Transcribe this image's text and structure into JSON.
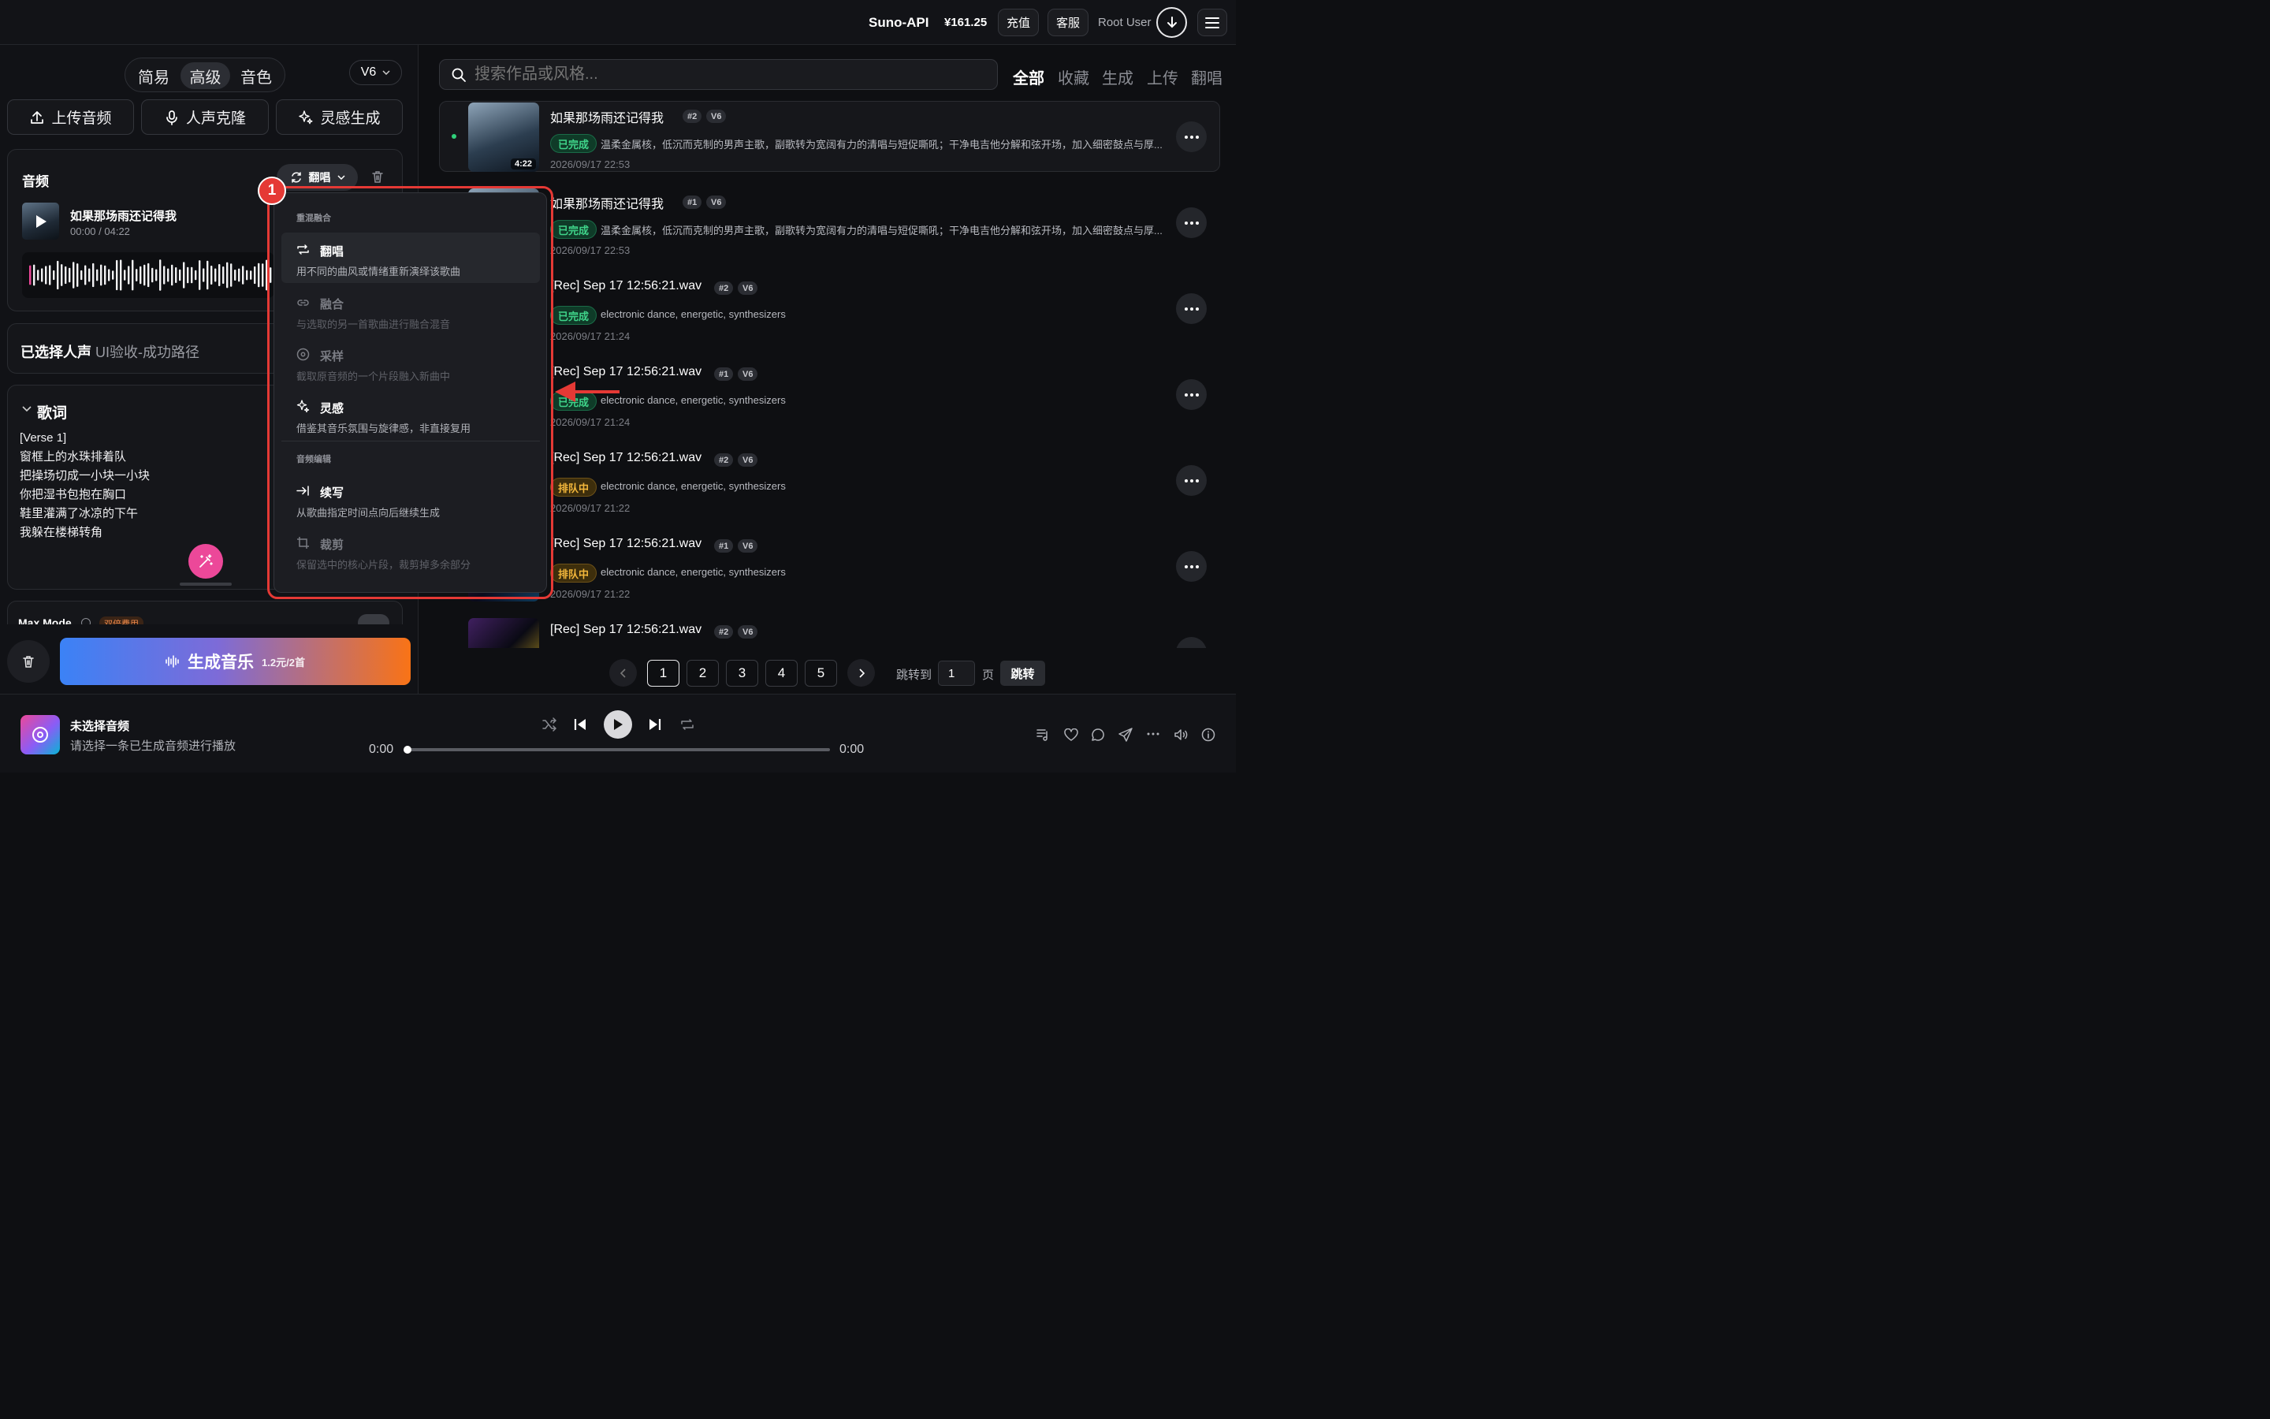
{
  "header": {
    "brand": "Suno-API",
    "balance": "¥161.25",
    "recharge": "充值",
    "support": "客服",
    "user": "Root User"
  },
  "left": {
    "modes": [
      "简易",
      "高级",
      "音色"
    ],
    "version": "V6",
    "tools": [
      "上传音频",
      "人声克隆",
      "灵感生成"
    ],
    "audio_card": {
      "title": "音频",
      "mode_button": "翻唱",
      "track_title": "如果那场雨还记得我",
      "time": "00:00 / 04:22"
    },
    "voice": {
      "label": "已选择人声",
      "value": "UI验收-成功路径"
    },
    "lyrics": {
      "title": "歌词",
      "lines": [
        "[Verse 1]",
        "窗框上的水珠排着队",
        "把操场切成一小块一小块",
        "你把湿书包抱在胸口",
        "鞋里灌满了冰凉的下午",
        "我躲在楼梯转角"
      ]
    },
    "max_mode": {
      "label": "Max Mode",
      "badge": "双倍费用"
    },
    "generate": {
      "label": "生成音乐",
      "price": "1.2元/2首"
    }
  },
  "dropdown": {
    "step_badge": "1",
    "section1": "重混融合",
    "section2": "音频编辑",
    "items": [
      {
        "title": "翻唱",
        "desc": "用不同的曲风或情绪重新演绎该歌曲",
        "icon": "repeat-icon",
        "enabled": true
      },
      {
        "title": "融合",
        "desc": "与选取的另一首歌曲进行融合混音",
        "icon": "link-icon",
        "enabled": false
      },
      {
        "title": "采样",
        "desc": "截取原音频的一个片段融入新曲中",
        "icon": "disc-icon",
        "enabled": false
      },
      {
        "title": "灵感",
        "desc": "借鉴其音乐氛围与旋律感，非直接复用",
        "icon": "sparkle-icon",
        "enabled": true
      },
      {
        "title": "续写",
        "desc": "从歌曲指定时间点向后继续生成",
        "icon": "arrow-right-bar-icon",
        "enabled": true
      },
      {
        "title": "裁剪",
        "desc": "保留选中的核心片段，裁剪掉多余部分",
        "icon": "crop-icon",
        "enabled": false
      }
    ]
  },
  "right": {
    "search_placeholder": "搜索作品或风格...",
    "tabs": [
      "全部",
      "收藏",
      "生成",
      "上传",
      "翻唱"
    ],
    "rows": [
      {
        "title": "如果那场雨还记得我",
        "num": "#2",
        "ver": "V6",
        "status": "已完成",
        "desc": "温柔金属核，低沉而克制的男声主歌，副歌转为宽阔有力的清唱与短促嘶吼；干净电吉他分解和弦开场，加入细密鼓点与厚...",
        "date": "2026/09/17 22:53",
        "duration": "4:22"
      },
      {
        "title": "如果那场雨还记得我",
        "num": "#1",
        "ver": "V6",
        "status": "已完成",
        "desc": "温柔金属核，低沉而克制的男声主歌，副歌转为宽阔有力的清唱与短促嘶吼；干净电吉他分解和弦开场，加入细密鼓点与厚...",
        "date": "2026/09/17 22:53"
      },
      {
        "title": "[Rec] Sep 17 12:56:21.wav",
        "num": "#2",
        "ver": "V6",
        "status": "已完成",
        "desc": "electronic dance, energetic, synthesizers",
        "date": "2026/09/17 21:24"
      },
      {
        "title": "[Rec] Sep 17 12:56:21.wav",
        "num": "#1",
        "ver": "V6",
        "status": "已完成",
        "desc": "electronic dance, energetic, synthesizers",
        "date": "2026/09/17 21:24"
      },
      {
        "title": "[Rec] Sep 17 12:56:21.wav",
        "num": "#2",
        "ver": "V6",
        "status": "排队中",
        "desc": "electronic dance, energetic, synthesizers",
        "date": "2026/09/17 21:22"
      },
      {
        "title": "[Rec] Sep 17 12:56:21.wav",
        "num": "#1",
        "ver": "V6",
        "status": "排队中",
        "desc": "electronic dance, energetic, synthesizers",
        "date": "2026/09/17 21:22"
      },
      {
        "title": "[Rec] Sep 17 12:56:21.wav",
        "num": "#2",
        "ver": "V6",
        "status": "",
        "desc": "",
        "date": ""
      }
    ],
    "pagination": {
      "pages": [
        "1",
        "2",
        "3",
        "4",
        "5"
      ],
      "jump_label": "跳转到",
      "jump_value": "1",
      "page_unit": "页",
      "jump_button": "跳转"
    }
  },
  "player": {
    "title": "未选择音频",
    "subtitle": "请选择一条已生成音频进行播放",
    "time_start": "0:00",
    "time_end": "0:00",
    "progress": 0
  },
  "colors": {
    "accent_pink": "#ec4899",
    "done_green": "#3fd48a",
    "queue_amber": "#f2b63b",
    "highlight_red": "#e53935"
  }
}
